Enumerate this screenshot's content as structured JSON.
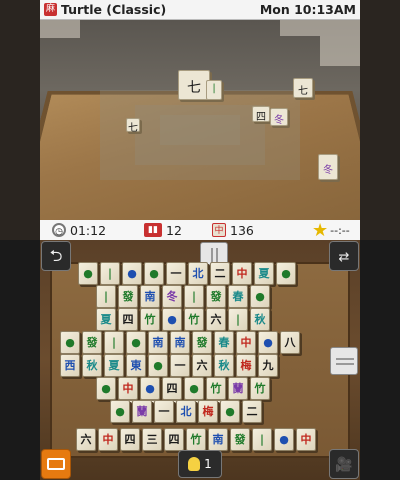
{
  "top": {
    "title": "Turtle (Classic)",
    "clock": "Mon 10:13AM",
    "scene_tiles": [
      {
        "glyph": "七",
        "color": "black"
      },
      {
        "glyph": "七",
        "color": "black"
      },
      {
        "glyph": "四",
        "color": "black"
      },
      {
        "glyph": "冬",
        "color": "purple"
      },
      {
        "glyph": "七",
        "color": "black"
      },
      {
        "glyph": "冬",
        "color": "purple"
      }
    ]
  },
  "status": {
    "time": "01:12",
    "pairs_left": "12",
    "tiles_left": "136",
    "rating": "--:--"
  },
  "controls": {
    "back_icon": "back-arrow-icon",
    "swap_icon": "swap-screens-icon",
    "menu_icon": "menu-icon",
    "camera_icon": "camera-icon",
    "hint_count": "1"
  },
  "board": {
    "tiles": [
      {
        "g": "●",
        "c": "green"
      },
      {
        "g": "|",
        "c": "green"
      },
      {
        "g": "●",
        "c": "blue"
      },
      {
        "g": "●",
        "c": "green"
      },
      {
        "g": "一",
        "c": "black"
      },
      {
        "g": "北",
        "c": "blue"
      },
      {
        "g": "二",
        "c": "black"
      },
      {
        "g": "中",
        "c": "red"
      },
      {
        "g": "夏",
        "c": "teal"
      },
      {
        "g": "●",
        "c": "green"
      },
      {
        "g": "|",
        "c": "green"
      },
      {
        "g": "發",
        "c": "green"
      },
      {
        "g": "南",
        "c": "blue"
      },
      {
        "g": "冬",
        "c": "purple"
      },
      {
        "g": "|",
        "c": "green"
      },
      {
        "g": "發",
        "c": "green"
      },
      {
        "g": "春",
        "c": "teal"
      },
      {
        "g": "●",
        "c": "green"
      },
      {
        "g": "夏",
        "c": "teal"
      },
      {
        "g": "四",
        "c": "black"
      },
      {
        "g": "竹",
        "c": "green"
      },
      {
        "g": "●",
        "c": "blue"
      },
      {
        "g": "竹",
        "c": "green"
      },
      {
        "g": "六",
        "c": "black"
      },
      {
        "g": "|",
        "c": "green"
      },
      {
        "g": "秋",
        "c": "teal"
      },
      {
        "g": "●",
        "c": "green"
      },
      {
        "g": "發",
        "c": "green"
      },
      {
        "g": "|",
        "c": "green"
      },
      {
        "g": "●",
        "c": "green"
      },
      {
        "g": "南",
        "c": "blue"
      },
      {
        "g": "南",
        "c": "blue"
      },
      {
        "g": "發",
        "c": "green"
      },
      {
        "g": "春",
        "c": "teal"
      },
      {
        "g": "中",
        "c": "red"
      },
      {
        "g": "●",
        "c": "blue"
      },
      {
        "g": "八",
        "c": "black"
      },
      {
        "g": "西",
        "c": "blue"
      },
      {
        "g": "秋",
        "c": "teal"
      },
      {
        "g": "夏",
        "c": "teal"
      },
      {
        "g": "東",
        "c": "blue"
      },
      {
        "g": "●",
        "c": "green"
      },
      {
        "g": "一",
        "c": "black"
      },
      {
        "g": "六",
        "c": "black"
      },
      {
        "g": "秋",
        "c": "teal"
      },
      {
        "g": "梅",
        "c": "red"
      },
      {
        "g": "九",
        "c": "black"
      },
      {
        "g": "●",
        "c": "green"
      },
      {
        "g": "中",
        "c": "red"
      },
      {
        "g": "●",
        "c": "blue"
      },
      {
        "g": "四",
        "c": "black"
      },
      {
        "g": "●",
        "c": "green"
      },
      {
        "g": "竹",
        "c": "green"
      },
      {
        "g": "蘭",
        "c": "purple"
      },
      {
        "g": "竹",
        "c": "green"
      },
      {
        "g": "●",
        "c": "green"
      },
      {
        "g": "●",
        "c": "blue"
      },
      {
        "g": "一",
        "c": "black"
      },
      {
        "g": "●",
        "c": "green"
      },
      {
        "g": "二",
        "c": "black"
      },
      {
        "g": "●",
        "c": "green"
      },
      {
        "g": "蘭",
        "c": "purple"
      },
      {
        "g": "一",
        "c": "black"
      },
      {
        "g": "北",
        "c": "blue"
      },
      {
        "g": "梅",
        "c": "red"
      },
      {
        "g": "●",
        "c": "green"
      },
      {
        "g": "二",
        "c": "black"
      },
      {
        "g": "六",
        "c": "black"
      },
      {
        "g": "中",
        "c": "red"
      },
      {
        "g": "四",
        "c": "black"
      },
      {
        "g": "三",
        "c": "black"
      },
      {
        "g": "四",
        "c": "black"
      },
      {
        "g": "竹",
        "c": "green"
      },
      {
        "g": "南",
        "c": "blue"
      },
      {
        "g": "發",
        "c": "green"
      },
      {
        "g": "|",
        "c": "green"
      },
      {
        "g": "●",
        "c": "blue"
      },
      {
        "g": "中",
        "c": "red"
      }
    ]
  }
}
